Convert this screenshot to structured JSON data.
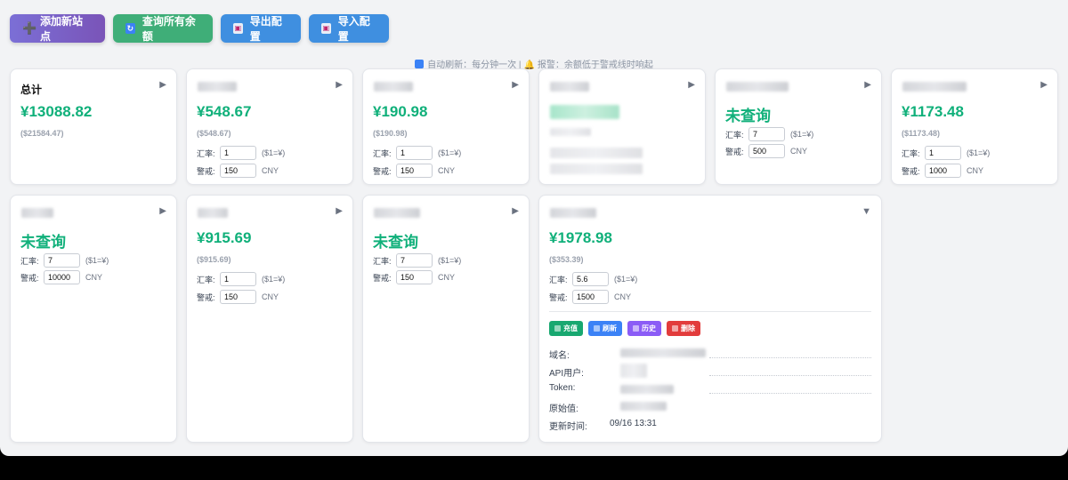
{
  "toolbar": {
    "add_label": "添加新站点",
    "query_label": "查询所有余额",
    "export_label": "导出配置",
    "import_label": "导入配置"
  },
  "info": {
    "refresh_text": "自动刷新：每分钟一次 |",
    "alert_text": "报警：余额低于警戒线时响起"
  },
  "labels": {
    "rate": "汇率:",
    "rate_suffix": "($1=¥)",
    "alert": "警戒:",
    "alert_suffix": "CNY",
    "collapsed": "▶",
    "expanded": "▼"
  },
  "total": {
    "title": "总计",
    "amount": "¥13088.82",
    "usd": "($21584.47)"
  },
  "cards": [
    {
      "amount": "¥548.67",
      "usd": "($548.67)",
      "rate": "1",
      "alert": "150"
    },
    {
      "amount": "¥190.98",
      "usd": "($190.98)",
      "rate": "1",
      "alert": "150"
    },
    {
      "amount": "",
      "usd": "",
      "rate": "",
      "alert": ""
    },
    {
      "amount": "未查询",
      "usd": "",
      "rate": "7",
      "alert": "500"
    },
    {
      "amount": "¥1173.48",
      "usd": "($1173.48)",
      "rate": "1",
      "alert": "1000"
    },
    {
      "amount": "未查询",
      "usd": "",
      "rate": "7",
      "alert": "10000"
    },
    {
      "amount": "¥915.69",
      "usd": "($915.69)",
      "rate": "1",
      "alert": "150"
    },
    {
      "amount": "未查询",
      "usd": "",
      "rate": "7",
      "alert": "150"
    }
  ],
  "expanded_card": {
    "amount": "¥1978.98",
    "usd": "($353.39)",
    "rate": "5.6",
    "alert": "1500",
    "actions": {
      "charge": "充值",
      "refresh": "刷新",
      "history": "历史",
      "delete": "删除"
    },
    "details": {
      "domain_label": "域名:",
      "api_user_label": "API用户:",
      "token_label": "Token:",
      "raw_label": "原始值:",
      "updated_label": "更新时间:",
      "updated_value": "09/16 13:31"
    }
  },
  "colors": {
    "accent_green": "#10b07a",
    "background": "#f2f3f5"
  }
}
